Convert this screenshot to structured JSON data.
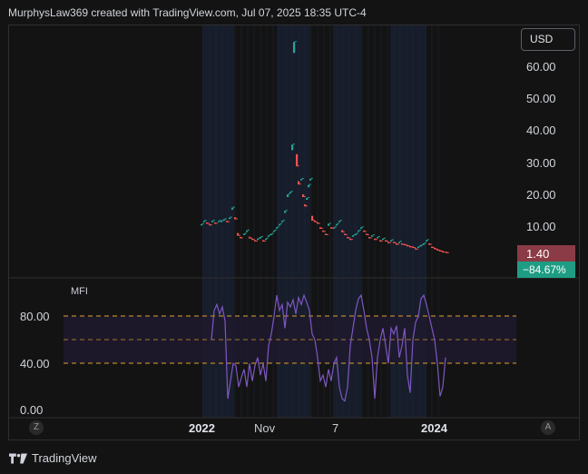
{
  "header": {
    "attribution": "MurphysLaw369 created with TradingView.com, Jul 07, 2025 18:35 UTC-4"
  },
  "price_scale": {
    "currency": "USD",
    "ticks": [
      "60.00",
      "50.00",
      "40.00",
      "30.00",
      "20.00",
      "10.00"
    ],
    "last_price": "1.40",
    "change_pct": "−84.67%"
  },
  "indicator": {
    "name": "MFI",
    "ticks": [
      "80.00",
      "40.00",
      "0.00"
    ],
    "upper_band": 80,
    "middle_band": 60,
    "lower_band": 40
  },
  "time_axis": {
    "labels": [
      "2022",
      "Nov",
      "7",
      "2024"
    ],
    "left_button": "Z",
    "right_button": "A"
  },
  "footer": {
    "brand": "TradingView"
  },
  "colors": {
    "background": "#131313",
    "up_candle": "#26a69a",
    "down_candle": "#ef5350",
    "mfi_line": "#7e57c2",
    "band_line": "#e0a030",
    "band_fill": "#1e1a2e",
    "session_shade": "#1a2233"
  }
}
